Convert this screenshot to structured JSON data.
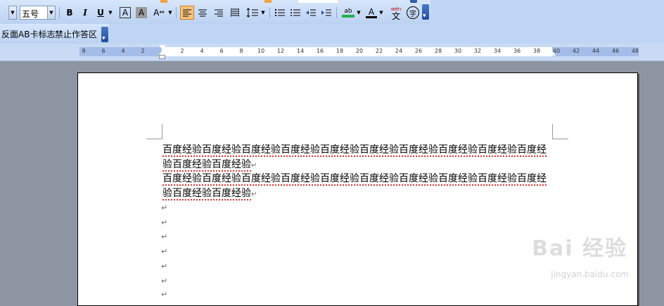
{
  "toolbar1": {
    "font_size": "五号",
    "bold": "B",
    "italic": "I",
    "underline": "U",
    "char_border": "A",
    "char_shading": "A",
    "char_scale": "A",
    "highlight_label": "ab",
    "font_color_label": "A",
    "phonetic_label": "wén",
    "phonetic_char": "文",
    "enclose_char": "字",
    "accent_color": "#f0a23c"
  },
  "toolbar2": {
    "item1": "反面AB卡标志",
    "item2": "禁止作答区"
  },
  "ruler": {
    "ticks": [
      "8",
      "6",
      "4",
      "2",
      "2",
      "4",
      "6",
      "8",
      "10",
      "12",
      "14",
      "16",
      "18",
      "20",
      "22",
      "24",
      "26",
      "28",
      "30",
      "32",
      "34",
      "36",
      "38",
      "40",
      "42",
      "44",
      "46",
      "48"
    ]
  },
  "document": {
    "lines": [
      "百度经验百度经验百度经验百度经验百度经验百度经验百度经验百度经验百度经验百度经",
      "验百度经验百度经验",
      "百度经验百度经验百度经验百度经验百度经验百度经验百度经验百度经验百度经验百度经",
      "验百度经验百度经验"
    ],
    "paragraph_mark": "↵"
  },
  "watermark": {
    "brand": "Bai 经验",
    "url": "jingyan.baidu.com"
  }
}
